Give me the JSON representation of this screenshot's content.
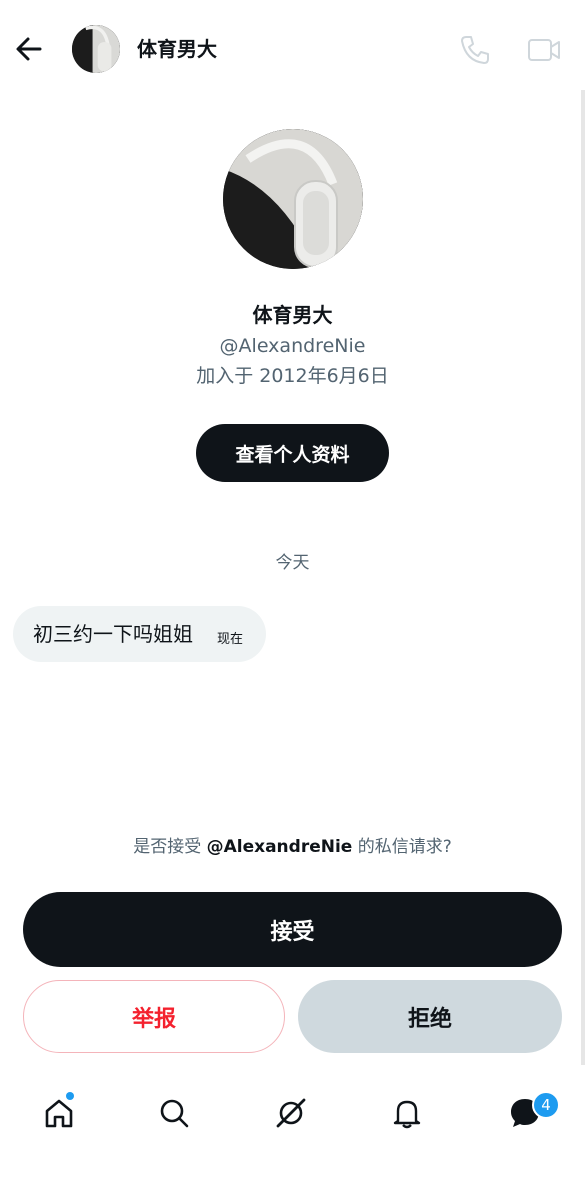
{
  "header": {
    "title": "体育男大",
    "icons": {
      "back": "arrow-left-icon",
      "call": "phone-icon",
      "video": "video-camera-icon"
    }
  },
  "profile": {
    "name": "体育男大",
    "handle": "@AlexandreNie",
    "joined": "加入于 2012年6月6日",
    "view_profile_label": "查看个人资料"
  },
  "conversation": {
    "date_separator": "今天",
    "messages": [
      {
        "text": "初三约一下吗姐姐",
        "time": "现在"
      }
    ]
  },
  "request": {
    "prompt_prefix": "是否接受 ",
    "prompt_handle": "@AlexandreNie",
    "prompt_suffix": " 的私信请求?",
    "accept_label": "接受",
    "report_label": "举报",
    "reject_label": "拒绝"
  },
  "bottom_nav": {
    "items": [
      "home-icon",
      "search-icon",
      "grok-icon",
      "notifications-bell-icon",
      "messages-icon"
    ],
    "messages_badge": "4"
  },
  "colors": {
    "text": "#0f1419",
    "muted": "#536471",
    "accent_blue": "#1d9bf0",
    "danger": "#f4212e",
    "bubble": "#eff3f4",
    "reject_bg": "#cfd9de"
  }
}
